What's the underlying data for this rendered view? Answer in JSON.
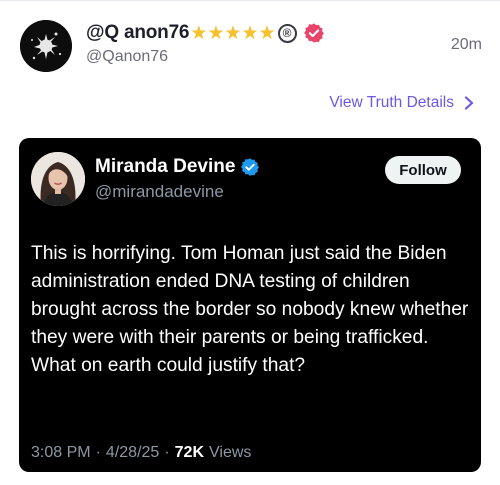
{
  "post": {
    "display_name": "@Q anon76",
    "star_count": 5,
    "registered_mark": "®",
    "handle": "@Qanon76",
    "time": "20m",
    "verified_color": "#e8456a"
  },
  "details_link": {
    "label": "View Truth Details",
    "color": "#6a58e6"
  },
  "embed": {
    "display_name": "Miranda Devine",
    "handle": "@mirandadevine",
    "follow_label": "Follow",
    "text": "This is horrifying. Tom Homan just said the Biden administration ended DNA testing of children brought across the border so nobody knew whether they were with their parents or being trafficked. What on earth could justify that?",
    "time": "3:08 PM",
    "date": "4/28/25",
    "views_count": "72K",
    "views_label": "Views",
    "separator": "·",
    "verified_color": "#1d9bf0"
  }
}
